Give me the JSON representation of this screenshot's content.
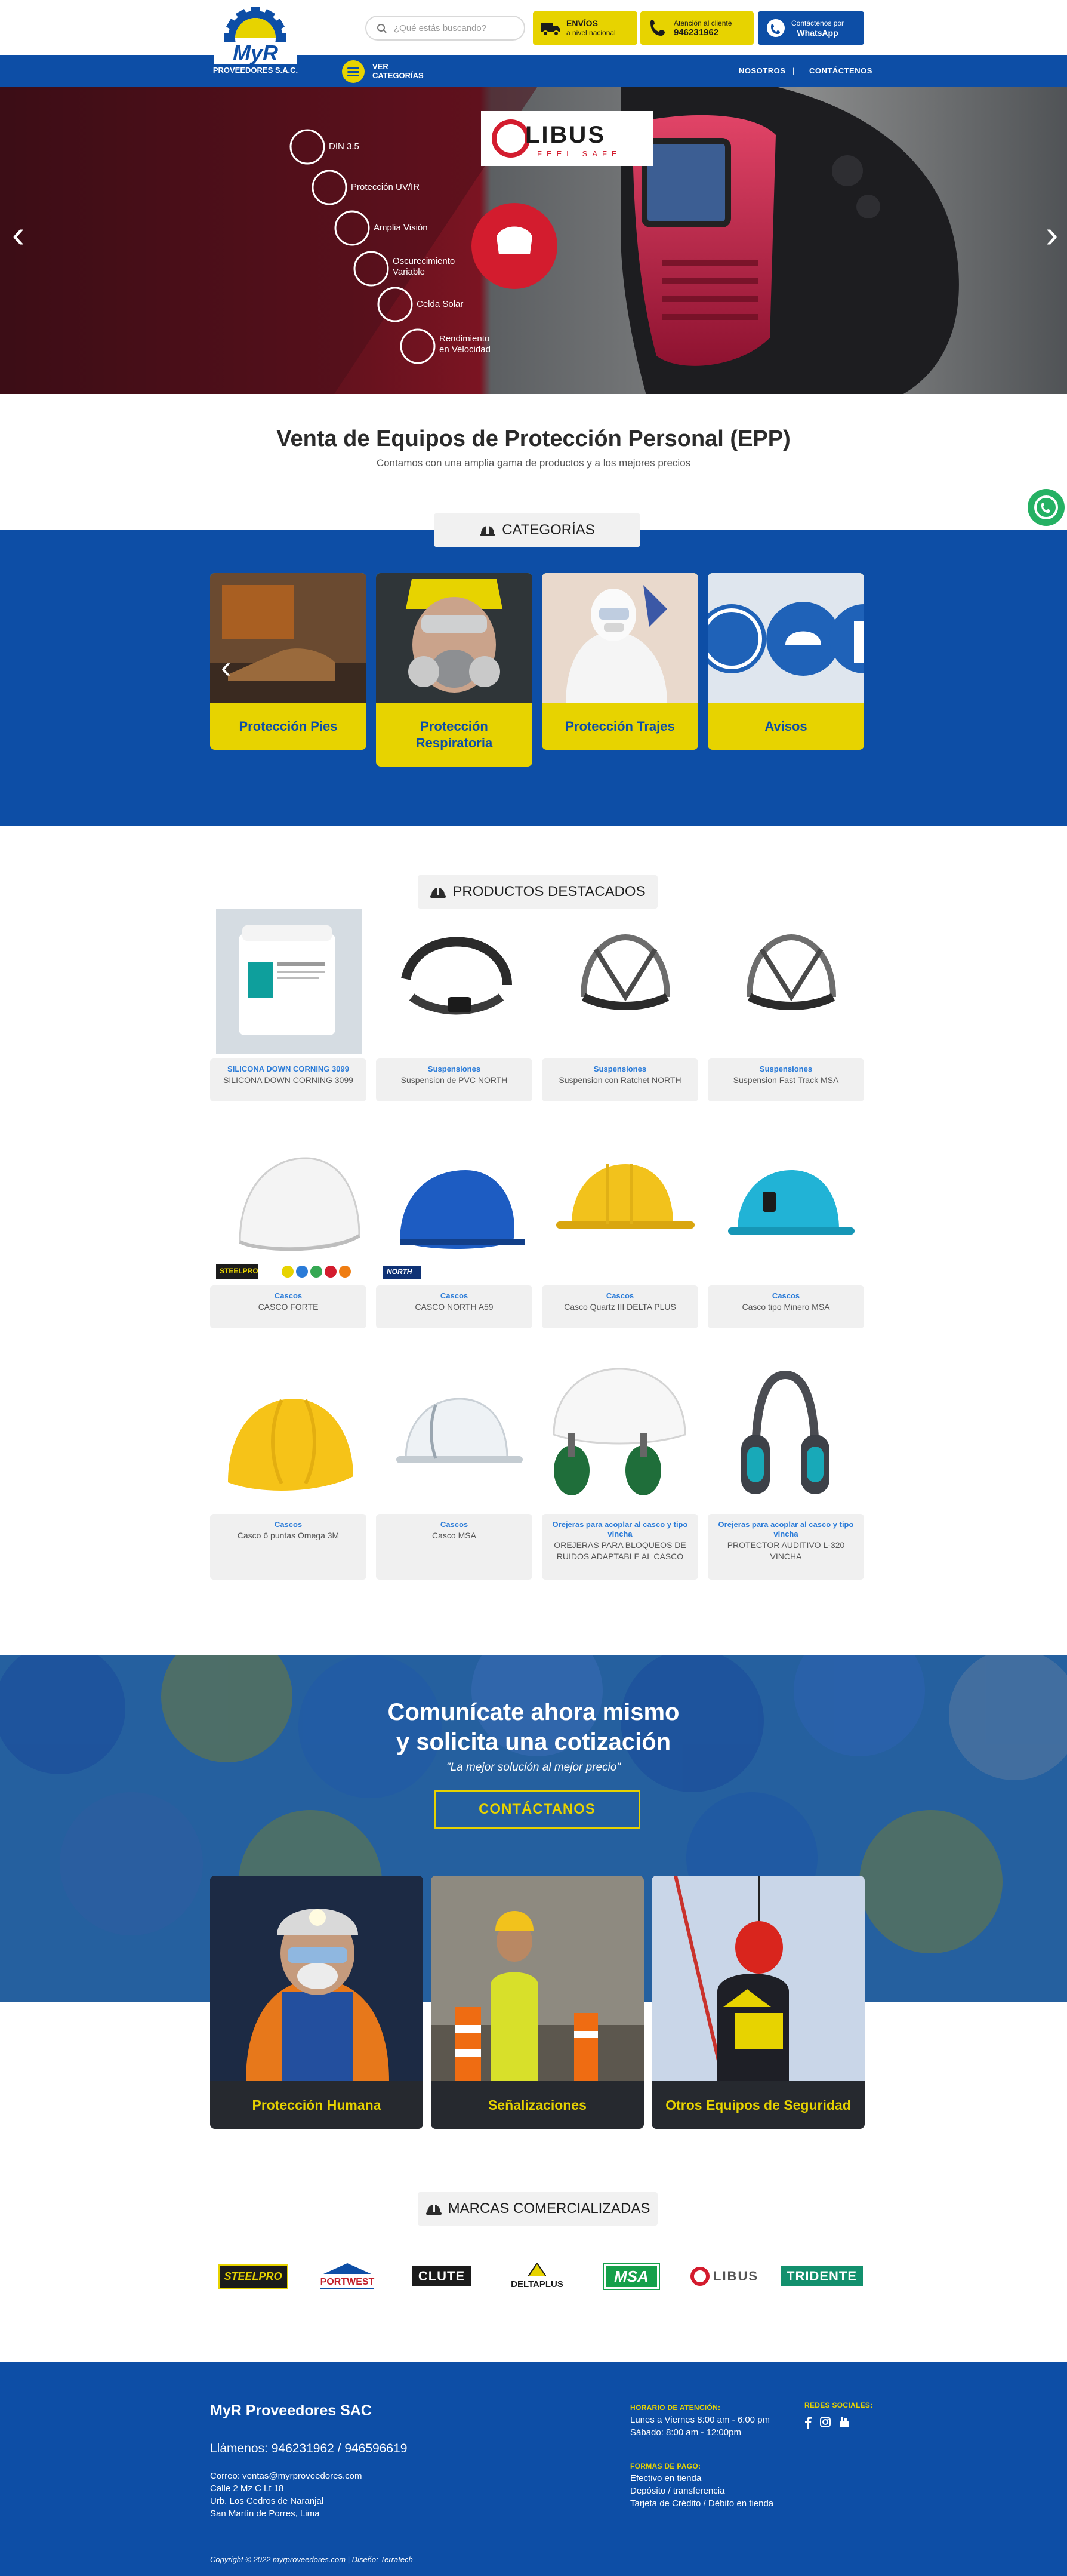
{
  "header": {
    "logo_text": "MyR",
    "logo_sub": "PROVEEDORES S.A.C.",
    "search_placeholder": "¿Qué estás buscando?",
    "envios_title": "ENVÍOS",
    "envios_sub": "a nivel nacional",
    "atencion_title": "Atención al cliente",
    "atencion_phone": "946231962",
    "whatsapp_title": "Contáctenos por",
    "whatsapp_sub": "WhatsApp",
    "ver": "VER",
    "categorias": "CATEGORÍAS",
    "nav": [
      "NOSOTROS",
      "CONTÁCTENOS"
    ],
    "nav_sep": "|"
  },
  "hero": {
    "brand": "LIBUS",
    "brand_tag": "FEEL SAFE",
    "features": [
      "DIN 3.5",
      "Protección UV/IR",
      "Amplia Visión",
      "Oscurecimiento Variable",
      "Celda Solar",
      "Rendimiento en Velocidad"
    ],
    "prev_arrow": "‹",
    "next_arrow": "›"
  },
  "intro": {
    "title": "Venta de Equipos de Protección Personal (EPP)",
    "subtitle": "Contamos con una amplia gama de productos y a los mejores precios"
  },
  "categories": {
    "heading": "CATEGORÍAS",
    "items": [
      {
        "label": "Protección Pies"
      },
      {
        "label": "Protección Respiratoria"
      },
      {
        "label": "Protección Trajes"
      },
      {
        "label": "Avisos"
      }
    ],
    "prev_arrow": "‹"
  },
  "products": {
    "heading": "PRODUCTOS DESTACADOS",
    "items": [
      {
        "category": "SILICONA DOWN CORNING 3099",
        "name": "SILICONA DOWN CORNING 3099"
      },
      {
        "category": "Suspensiones",
        "name": "Suspension de PVC NORTH"
      },
      {
        "category": "Suspensiones",
        "name": "Suspension con Ratchet NORTH"
      },
      {
        "category": "Suspensiones",
        "name": "Suspension Fast Track MSA"
      },
      {
        "category": "Cascos",
        "name": "CASCO FORTE",
        "badge": "STEELPRO"
      },
      {
        "category": "Cascos",
        "name": "CASCO NORTH A59",
        "badge": "NORTH"
      },
      {
        "category": "Cascos",
        "name": "Casco Quartz III DELTA PLUS"
      },
      {
        "category": "Cascos",
        "name": "Casco tipo Minero MSA"
      },
      {
        "category": "Cascos",
        "name": "Casco 6 puntas Omega 3M"
      },
      {
        "category": "Cascos",
        "name": "Casco MSA"
      },
      {
        "category": "Orejeras para acoplar al casco y tipo vincha",
        "name": "OREJERAS PARA BLOQUEOS DE RUIDOS ADAPTABLE AL CASCO"
      },
      {
        "category": "Orejeras para acoplar al casco y tipo vincha",
        "name": "PROTECTOR AUDITIVO L-320 VINCHA"
      }
    ]
  },
  "cta": {
    "title_line1": "Comunícate ahora mismo",
    "title_line2": "y solicita una cotización",
    "quote": "\"La mejor solución al mejor precio\"",
    "button": "CONTÁCTANOS",
    "cards": [
      {
        "label": "Protección Humana"
      },
      {
        "label": "Señalizaciones"
      },
      {
        "label": "Otros Equipos de Seguridad"
      }
    ]
  },
  "brands": {
    "heading": "MARCAS COMERCIALIZADAS",
    "items": [
      "STEELPRO",
      "PORTWEST",
      "CLUTE",
      "DELTAPLUS",
      "MSA",
      "LIBUS",
      "TRIDENTE"
    ]
  },
  "footer": {
    "company": "MyR Proveedores SAC",
    "phones": "Llámenos: 946231962 / 946596619",
    "email": "Correo: ventas@myrproveedores.com",
    "address1": "Calle 2 Mz C Lt 18",
    "address2": "Urb. Los Cedros de Naranjal",
    "address3": "San Martín de Porres, Lima",
    "hours_title": "HORARIO DE ATENCIÓN:",
    "hours1": "Lunes a Viernes 8:00 am - 6:00 pm",
    "hours2": "Sábado: 8:00 am - 12:00pm",
    "pay_title": "FORMAS DE PAGO:",
    "pay1": "Efectivo en tienda",
    "pay2": "Depósito / transferencia",
    "pay3": "Tarjeta de Crédito / Débito en tienda",
    "social_title": "REDES SOCIALES:",
    "copyright": "Copyright © 2022 myrproveedores.com | Diseño: Terratech"
  },
  "colors": {
    "blue": "#0d4ea6",
    "yellow": "#e7d300",
    "whatsapp": "#25b163",
    "dark": "#26292f"
  }
}
